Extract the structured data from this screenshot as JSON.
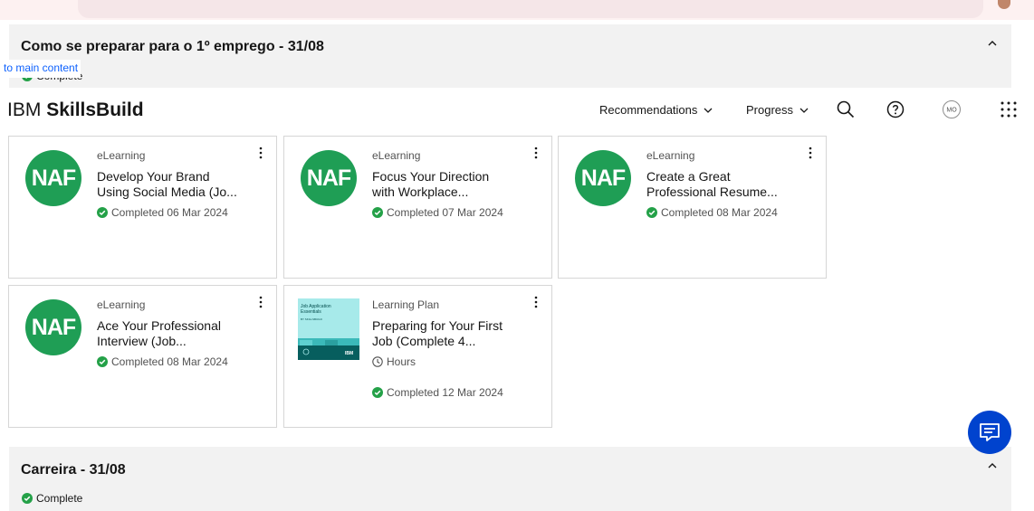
{
  "sections": {
    "top": {
      "title": "Como se preparar para o 1º emprego - 31/08",
      "status": "Complete"
    },
    "bottom": {
      "title": "Carreira - 31/08",
      "status": "Complete"
    }
  },
  "skip_link": "to main content",
  "header": {
    "brand_light": "IBM",
    "brand_bold": "SkillsBuild",
    "nav": {
      "recommendations": "Recommendations",
      "progress": "Progress"
    },
    "avatar_initials": "MO"
  },
  "logo_text": "NAF",
  "cards": [
    {
      "type": "eLearning",
      "title_line1": "Develop Your Brand",
      "title_line2": "Using Social Media (Jo...",
      "status": "Completed 06 Mar 2024"
    },
    {
      "type": "eLearning",
      "title_line1": "Focus Your Direction",
      "title_line2": "with Workplace...",
      "status": "Completed 07 Mar 2024"
    },
    {
      "type": "eLearning",
      "title_line1": "Create a Great",
      "title_line2": "Professional Resume...",
      "status": "Completed 08 Mar 2024"
    },
    {
      "type": "eLearning",
      "title_line1": "Ace Your Professional",
      "title_line2": "Interview (Job...",
      "status": "Completed 08 Mar 2024"
    },
    {
      "type": "Learning Plan",
      "title_line1": "Preparing for Your First",
      "title_line2": "Job (Complete 4...",
      "duration": "Hours",
      "status": "Completed 12 Mar 2024",
      "thumb": {
        "title_line1": "Job Application",
        "title_line2": "Essentials",
        "subtitle": "BY SKILLSBUILD",
        "brand": "IBM"
      }
    }
  ],
  "colors": {
    "success": "#24a148",
    "naf_green": "#1f9e55",
    "chat_blue": "#0043ce",
    "section_bg": "#f2f2f2",
    "link_blue": "#0f62fe"
  },
  "icons": {
    "status": "checkmark-filled-icon",
    "nav_dropdown": "chevron-down-icon",
    "section_toggle": "chevron-up-icon",
    "search": "search-icon",
    "help": "help-icon",
    "apps": "app-switcher-icon",
    "overflow": "overflow-menu-icon",
    "duration": "clock-icon",
    "chat": "chat-icon"
  }
}
